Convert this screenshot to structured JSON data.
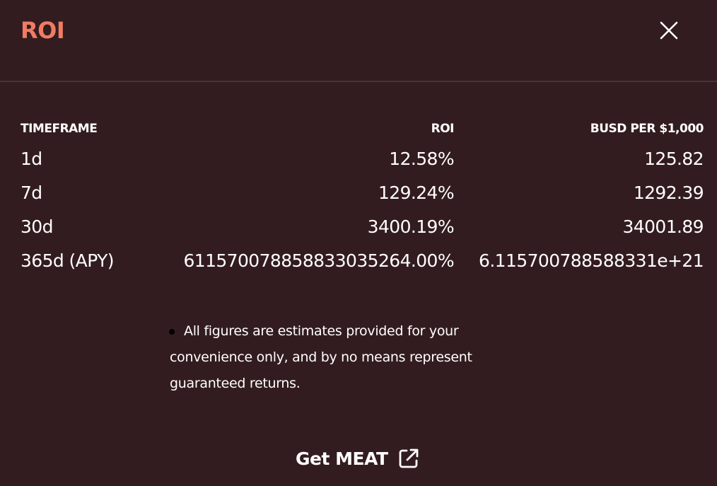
{
  "modal": {
    "title": "ROI",
    "close_icon": "close-icon"
  },
  "table": {
    "headers": {
      "timeframe": "TIMEFRAME",
      "roi": "ROI",
      "busd": "BUSD PER $1,000"
    },
    "rows": [
      {
        "timeframe": "1d",
        "roi": "12.58%",
        "busd": "125.82"
      },
      {
        "timeframe": "7d",
        "roi": "129.24%",
        "busd": "1292.39"
      },
      {
        "timeframe": "30d",
        "roi": "3400.19%",
        "busd": "34001.89"
      },
      {
        "timeframe": "365d (APY)",
        "roi": "611570078858833035264.00%",
        "busd": "6.115700788588331e+21"
      }
    ]
  },
  "disclaimer": {
    "text": "All figures are estimates provided for your convenience only, and by no means represent guaranteed returns."
  },
  "footer": {
    "link_label": "Get MEAT",
    "link_icon": "external-link-icon"
  },
  "colors": {
    "background": "#331c1f",
    "accent": "#ef7c63",
    "divider": "#4a3338",
    "text": "#ffffff"
  }
}
